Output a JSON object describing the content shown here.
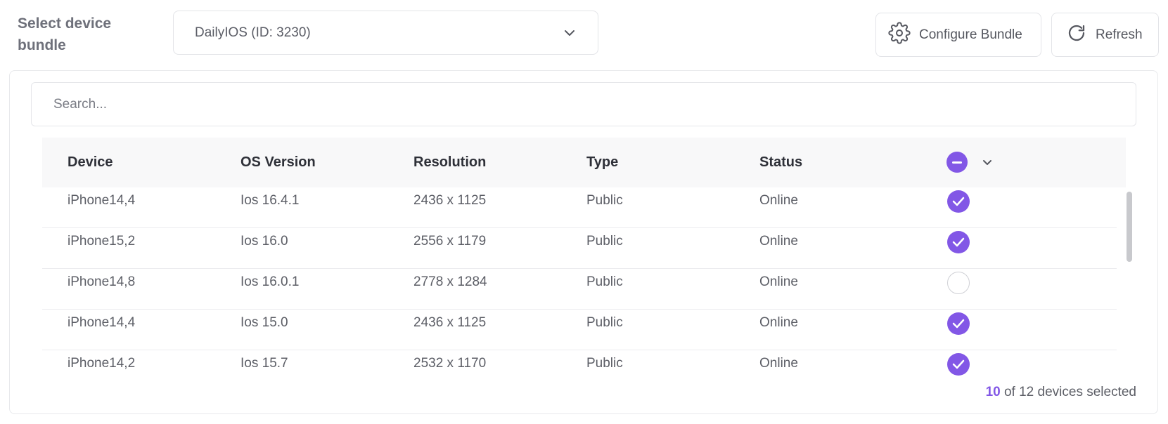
{
  "header": {
    "bundle_label": "Select device bundle",
    "select_value": "DailyIOS (ID: 3230)",
    "configure_label": "Configure Bundle",
    "refresh_label": "Refresh"
  },
  "search": {
    "placeholder": "Search..."
  },
  "table": {
    "columns": [
      "Device",
      "OS Version",
      "Resolution",
      "Type",
      "Status"
    ],
    "rows": [
      {
        "device": "iPhone14,4",
        "os": "Ios 16.4.1",
        "resolution": "2436 x 1125",
        "type": "Public",
        "status": "Online",
        "selected": true
      },
      {
        "device": "iPhone15,2",
        "os": "Ios 16.0",
        "resolution": "2556 x 1179",
        "type": "Public",
        "status": "Online",
        "selected": true
      },
      {
        "device": "iPhone14,8",
        "os": "Ios 16.0.1",
        "resolution": "2778 x 1284",
        "type": "Public",
        "status": "Online",
        "selected": false
      },
      {
        "device": "iPhone14,4",
        "os": "Ios 15.0",
        "resolution": "2436 x 1125",
        "type": "Public",
        "status": "Online",
        "selected": true
      },
      {
        "device": "iPhone14,2",
        "os": "Ios 15.7",
        "resolution": "2532 x 1170",
        "type": "Public",
        "status": "Online",
        "selected": true
      }
    ]
  },
  "footer": {
    "selected_count": "10",
    "suffix": " of 12 devices selected"
  },
  "icons": {
    "configure": "gear-icon",
    "refresh": "refresh-icon",
    "dropdown": "chevron-down-icon",
    "row_selected": "check-circle-icon",
    "header_select": "minus-circle-icon"
  },
  "colors": {
    "accent": "#8257e6"
  }
}
